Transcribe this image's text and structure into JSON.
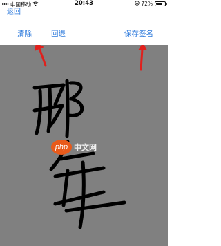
{
  "status_bar": {
    "carrier": "中国移动",
    "time": "20:43",
    "battery": "72%",
    "battery_level": 0.72
  },
  "nav": {
    "back_label": "返回"
  },
  "toolbar": {
    "clear_label": "清除",
    "undo_label": "回退",
    "save_label": "保存签名"
  },
  "watermark": {
    "logo_text": "php",
    "site_text": "中文网"
  },
  "colors": {
    "accent": "#2f7bdc",
    "canvas_bg": "#808080",
    "arrow": "#e0201c",
    "ink": "#000000"
  }
}
